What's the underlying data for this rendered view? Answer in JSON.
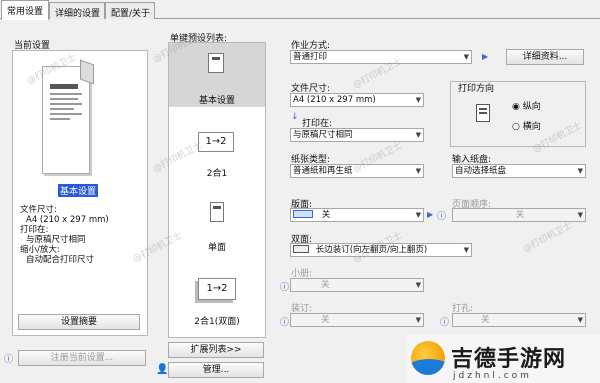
{
  "tabs": [
    {
      "label": "常用设置",
      "active": true
    },
    {
      "label": "详细的设置",
      "active": false
    },
    {
      "label": "配置/关于",
      "active": false
    }
  ],
  "current_settings": {
    "title": "当前设置",
    "preview_label": "基本设置",
    "details": [
      "文件尺寸:",
      "A4 (210 x 297 mm)",
      "打印在:",
      "与原稿尺寸相同",
      "缩小/放大:",
      "自动配合打印尺寸"
    ],
    "summary_button": "设置摘要"
  },
  "register_button": "注册当前设置...",
  "presets": {
    "title": "单键预设列表:",
    "items": [
      {
        "label": "基本设置",
        "selected": true
      },
      {
        "label": "2合1",
        "selected": false
      },
      {
        "label": "单面",
        "selected": false
      },
      {
        "label": "2合1(双面)",
        "selected": false
      }
    ],
    "expand_button": "扩展列表>>",
    "manage_button": "管理..."
  },
  "job_mode": {
    "label": "作业方式:",
    "value": "普通打印",
    "details_button": "详细资料..."
  },
  "paper_size": {
    "label": "文件尺寸:",
    "value": "A4 (210 x 297 mm)"
  },
  "print_on": {
    "label": "打印在:",
    "value": "与原稿尺寸相同"
  },
  "orientation": {
    "label": "打印方向",
    "options": [
      "纵向",
      "横向"
    ],
    "selected": "纵向"
  },
  "paper_type": {
    "label": "纸张类型:",
    "value": "普通纸和再生纸"
  },
  "input_tray": {
    "label": "输入纸盘:",
    "value": "自动选择纸盘"
  },
  "layout": {
    "label": "版面:",
    "value": "关"
  },
  "page_order": {
    "label": "页面顺序:",
    "value": "关"
  },
  "duplex": {
    "label": "双面:",
    "value": "长边装订(向左翻页/向上翻页)"
  },
  "booklet": {
    "label": "小册:",
    "value": "关"
  },
  "binding": {
    "label": "装订:",
    "value": "关"
  },
  "punch": {
    "label": "打孔:",
    "value": "关"
  },
  "watermark": {
    "text": "@打印机卫士"
  },
  "logo": {
    "name": "吉德手游网",
    "url": "jdzhnl.com"
  }
}
